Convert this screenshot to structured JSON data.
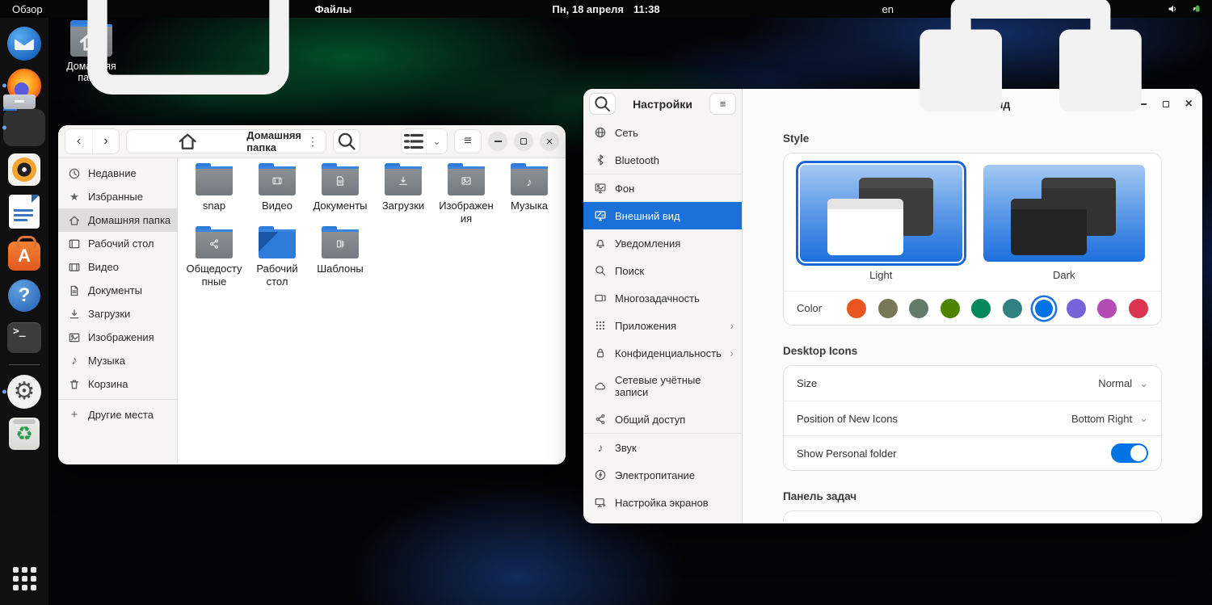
{
  "icons": {
    "back": "‹",
    "forward": "›",
    "menu_dots": "⋮",
    "hamburger": "≡",
    "chevron_down": "⌄",
    "chevron_right": "›",
    "close": "×",
    "star": "★",
    "plus": "+",
    "music_note": "♪",
    "question": "?",
    "gear": "⚙",
    "recycle": "♻",
    "terminal_prompt": ">_",
    "software_letter": "A"
  },
  "topbar": {
    "activities": "Обзор",
    "app_name": "Файлы",
    "date": "Пн, 18 апреля",
    "time": "11:38",
    "keyboard": "en"
  },
  "desktop": {
    "home_label": "Домашняя папка"
  },
  "files": {
    "location": "Домашняя папка",
    "sidebar": [
      {
        "label": "Недавние"
      },
      {
        "label": "Избранные"
      },
      {
        "label": "Домашняя папка",
        "selected": true
      },
      {
        "label": "Рабочий стол"
      },
      {
        "label": "Видео"
      },
      {
        "label": "Документы"
      },
      {
        "label": "Загрузки"
      },
      {
        "label": "Изображения"
      },
      {
        "label": "Музыка"
      },
      {
        "label": "Корзина"
      }
    ],
    "other_places": "Другие места",
    "folders": [
      {
        "label": "snap"
      },
      {
        "label": "Видео"
      },
      {
        "label": "Документы"
      },
      {
        "label": "Загрузки"
      },
      {
        "label": "Изображения"
      },
      {
        "label": "Музыка"
      },
      {
        "label": "Общедоступные"
      },
      {
        "label": "Рабочий стол"
      },
      {
        "label": "Шаблоны"
      }
    ]
  },
  "settings": {
    "sidebar_title": "Настройки",
    "window_title": "Внешний вид",
    "sidebar": [
      {
        "label": "Сеть"
      },
      {
        "label": "Bluetooth"
      },
      {
        "label": "Фон"
      },
      {
        "label": "Внешний вид",
        "selected": true
      },
      {
        "label": "Уведомления"
      },
      {
        "label": "Поиск"
      },
      {
        "label": "Многозадачность"
      },
      {
        "label": "Приложения",
        "expandable": true
      },
      {
        "label": "Конфиденциальность",
        "expandable": true
      },
      {
        "label": "Сетевые учётные записи"
      },
      {
        "label": "Общий доступ"
      },
      {
        "label": "Звук"
      },
      {
        "label": "Электропитание"
      },
      {
        "label": "Настройка экранов"
      }
    ],
    "style": {
      "heading": "Style",
      "light_label": "Light",
      "dark_label": "Dark",
      "selected": "Light",
      "color_label": "Color",
      "accent_colors": [
        "#E95420",
        "#787859",
        "#657B69",
        "#4B8501",
        "#03875B",
        "#308280",
        "#0073E5",
        "#7764D8",
        "#B34CB3",
        "#DA3450"
      ],
      "selected_color": "#0073E5",
      "selected_color_index": 6
    },
    "desktop_icons": {
      "heading": "Desktop Icons",
      "size_label": "Size",
      "size_value": "Normal",
      "position_label": "Position of New Icons",
      "position_value": "Bottom Right",
      "personal_label": "Show Personal folder",
      "personal_on": true
    },
    "taskbar_heading": "Панель задач"
  }
}
